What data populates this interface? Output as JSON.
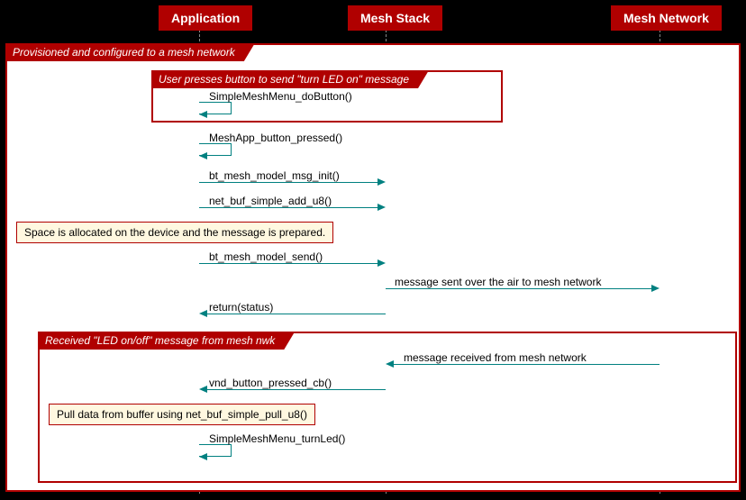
{
  "participants": [
    "Application",
    "Mesh Stack",
    "Mesh Network"
  ],
  "groups": {
    "outer": "Provisioned and configured to a mesh network",
    "press": "User presses button to send \"turn LED on\" message",
    "receive": "Received \"LED on/off\" message from mesh nwk"
  },
  "messages": [
    "SimpleMeshMenu_doButton()",
    "MeshApp_button_pressed()",
    "bt_mesh_model_msg_init()",
    "net_buf_simple_add_u8()",
    "bt_mesh_model_send()",
    "message sent over the air to mesh network",
    "return(status)",
    "message received from mesh network",
    "vnd_button_pressed_cb()",
    "SimpleMeshMenu_turnLed()"
  ],
  "notes": [
    "Space is allocated on the device and the message is prepared.",
    "Pull data from buffer using net_buf_simple_pull_u8()"
  ]
}
